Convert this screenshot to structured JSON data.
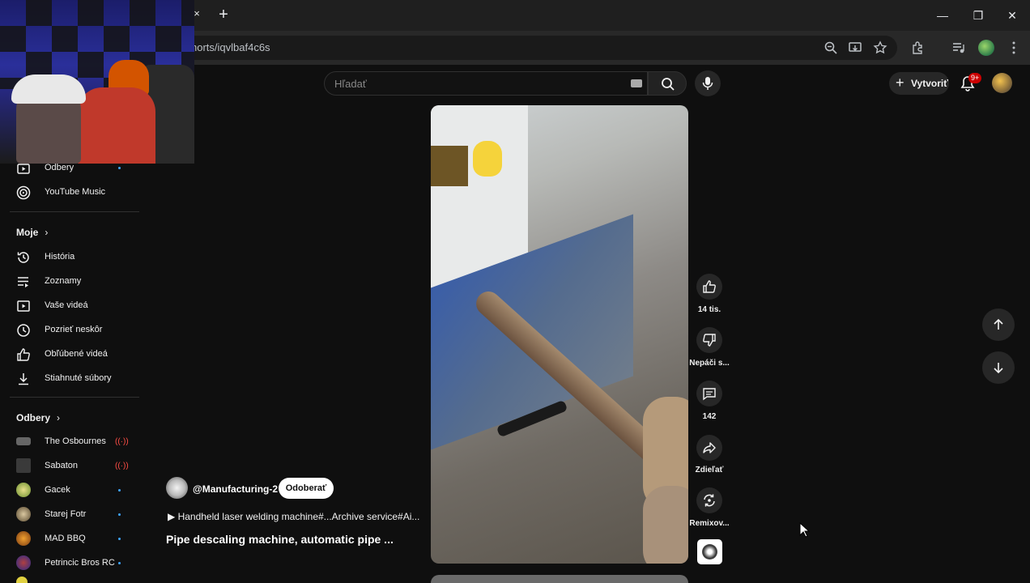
{
  "browser": {
    "url": "horts/iqvlbaf4c6s",
    "new_tab_label": "+",
    "tab_close": "×",
    "window_controls": [
      "—",
      "❐",
      "✕"
    ]
  },
  "header": {
    "search_placeholder": "Hľadať",
    "create_label": "Vytvoriť",
    "notifications_badge": "9+"
  },
  "sidebar": {
    "top_items": [
      {
        "label": "Odbery",
        "icon": "subscriptions-icon"
      },
      {
        "label": "YouTube Music",
        "icon": "youtube-music-icon"
      }
    ],
    "you_section": {
      "title": "Moje",
      "items": [
        {
          "label": "História",
          "icon": "history-icon"
        },
        {
          "label": "Zoznamy",
          "icon": "playlists-icon"
        },
        {
          "label": "Vaše videá",
          "icon": "your-videos-icon"
        },
        {
          "label": "Pozrieť neskôr",
          "icon": "watch-later-icon"
        },
        {
          "label": "Obľúbené videá",
          "icon": "liked-videos-icon"
        },
        {
          "label": "Stiahnuté súbory",
          "icon": "downloads-icon"
        }
      ]
    },
    "subs_section": {
      "title": "Odbery",
      "channels": [
        {
          "label": "The Osbournes",
          "status": "live"
        },
        {
          "label": "Sabaton",
          "status": "live"
        },
        {
          "label": "Gacek",
          "status": "new"
        },
        {
          "label": "Starej Fotr",
          "status": "new"
        },
        {
          "label": "MAD BBQ",
          "status": "new"
        },
        {
          "label": "Petrincic Bros RC",
          "status": "new"
        }
      ]
    }
  },
  "short": {
    "channel": "@Manufacturing-2",
    "subscribe_label": "Odoberať",
    "music": "Handheld laser welding machine#...Archive service#Ai...",
    "title": "Pipe descaling machine, automatic pipe ..."
  },
  "actions": {
    "like_count": "14 tis.",
    "dislike_label": "Nepáči s...",
    "comments_count": "142",
    "share_label": "Zdieľať",
    "remix_label": "Remixov..."
  },
  "colors": {
    "background": "#0f0f0f",
    "accent_live": "#ff4e45",
    "new_dot": "#3ea6ff",
    "badge": "#cc0000"
  }
}
